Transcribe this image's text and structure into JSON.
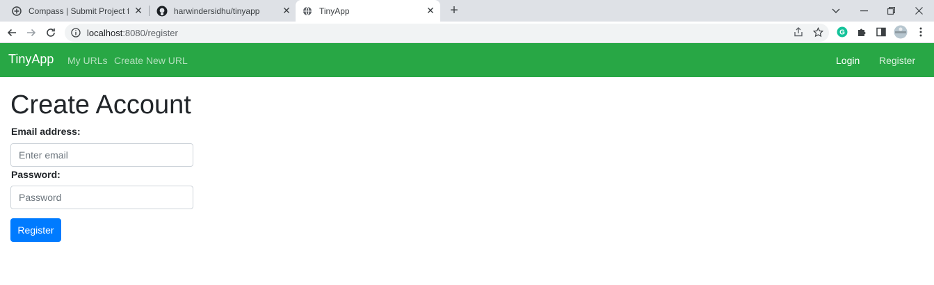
{
  "browser": {
    "tabs": [
      {
        "title": "Compass | Submit Project for Eva",
        "favicon": "compass-icon"
      },
      {
        "title": "harwindersidhu/tinyapp",
        "favicon": "github-icon"
      },
      {
        "title": "TinyApp",
        "favicon": "globe-icon",
        "active": true
      }
    ],
    "url_host": "localhost",
    "url_rest": ":8080/register"
  },
  "navbar": {
    "brand": "TinyApp",
    "links": [
      "My URLs",
      "Create New URL"
    ],
    "login": "Login",
    "register": "Register",
    "color": "#28a745"
  },
  "form": {
    "heading": "Create Account",
    "email_label": "Email address:",
    "email_placeholder": "Enter email",
    "password_label": "Password:",
    "password_placeholder": "Password",
    "submit_label": "Register",
    "button_color": "#007bff"
  }
}
